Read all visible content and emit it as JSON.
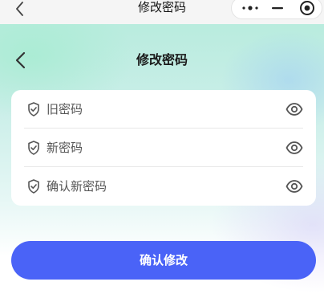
{
  "system_bar": {
    "title": "修改密码"
  },
  "header": {
    "title": "修改密码"
  },
  "form": {
    "fields": [
      {
        "label": "旧密码",
        "icon": "shield-icon",
        "action_icon": "eye-icon"
      },
      {
        "label": "新密码",
        "icon": "shield-icon",
        "action_icon": "eye-icon"
      },
      {
        "label": "确认新密码",
        "icon": "shield-icon",
        "action_icon": "eye-icon"
      }
    ]
  },
  "submit": {
    "label": "确认修改"
  },
  "colors": {
    "primary": "#4a63f7",
    "gradient_mint": "#b9ecde",
    "gradient_lavender": "#d6cef8"
  }
}
